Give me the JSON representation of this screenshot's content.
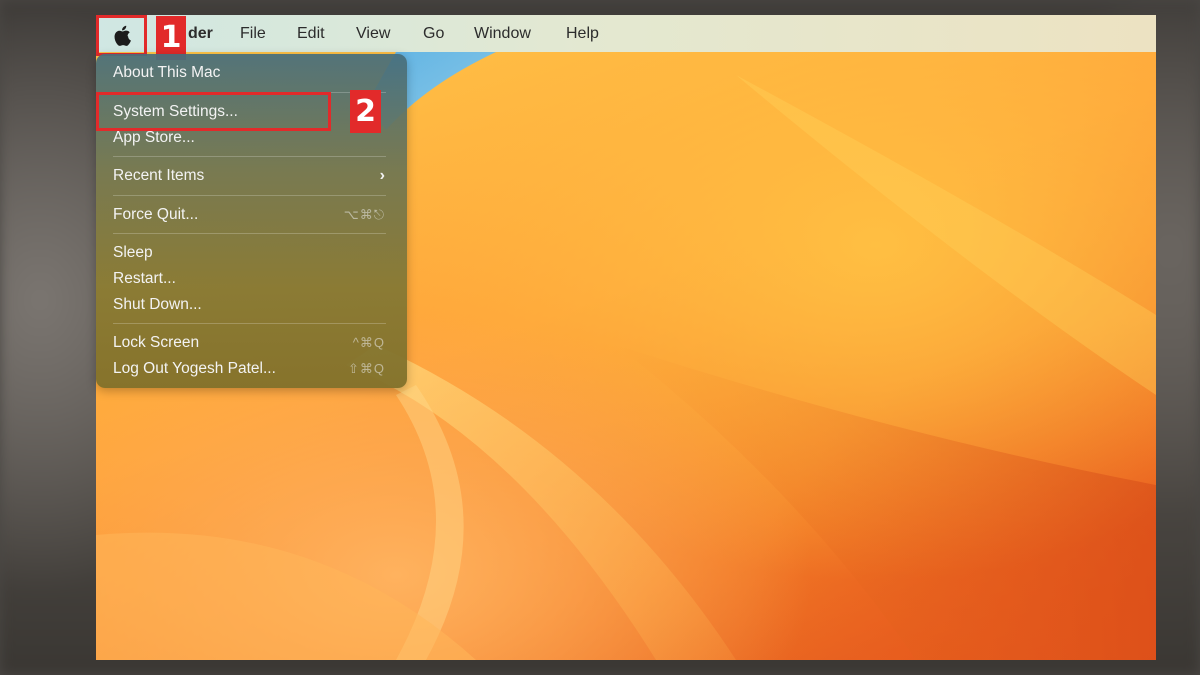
{
  "menubar": {
    "apple_icon": "apple-logo-icon",
    "items": [
      "Finder",
      "File",
      "Edit",
      "View",
      "Go",
      "Window",
      "Help"
    ],
    "finder_visible_text": "der"
  },
  "apple_menu": {
    "items": [
      {
        "label": "About This Mac"
      },
      {
        "label": "System Settings..."
      },
      {
        "label": "App Store..."
      },
      {
        "label": "Recent Items",
        "submenu_icon": "chevron-right-icon"
      },
      {
        "label": "Force Quit...",
        "shortcut": "⌥⌘⎋"
      },
      {
        "label": "Sleep"
      },
      {
        "label": "Restart..."
      },
      {
        "label": "Shut Down..."
      },
      {
        "label": "Lock Screen",
        "shortcut": "^⌘Q"
      },
      {
        "label": "Log Out Yogesh Patel...",
        "shortcut": "⇧⌘Q"
      }
    ]
  },
  "annotations": {
    "step1": "1",
    "step2": "2",
    "color": "#e22a2a"
  },
  "colors": {
    "wallpaper_primary": "#ffa43a",
    "wallpaper_deep": "#e0521c"
  }
}
